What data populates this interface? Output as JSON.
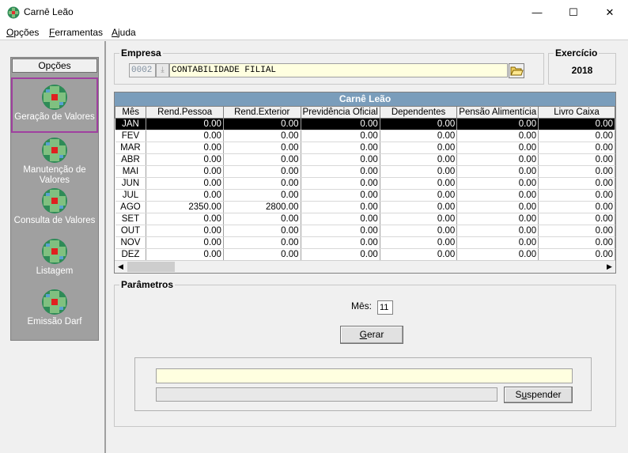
{
  "window": {
    "title": "Carnê Leão",
    "minimize_glyph": "—",
    "maximize_glyph": "☐",
    "close_glyph": "✕"
  },
  "menu": [
    {
      "label": "Opções",
      "underline": "O",
      "rest": "pções"
    },
    {
      "label": "Ferramentas",
      "underline": "F",
      "rest": "erramentas"
    },
    {
      "label": "Ajuda",
      "underline": "A",
      "rest": "juda"
    }
  ],
  "sidebar": {
    "header": "Opções",
    "items": [
      {
        "label": "Geração de Valores",
        "selected": true
      },
      {
        "label": "Manutenção de Valores",
        "selected": false
      },
      {
        "label": "Consulta de Valores",
        "selected": false
      },
      {
        "label": "Listagem",
        "selected": false
      },
      {
        "label": "Emissão Darf",
        "selected": false
      }
    ]
  },
  "empresa": {
    "group_label": "Empresa",
    "code": "0002",
    "name": "CONTABILIDADE FILIAL"
  },
  "exercicio": {
    "group_label": "Exercício",
    "year": "2018"
  },
  "grid": {
    "title": "Carnê Leão",
    "columns": [
      "Mês",
      "Rend.Pessoa",
      "Rend.Exterior",
      "Previdência Oficial",
      "Dependentes",
      "Pensão Alimentícia",
      "Livro Caixa"
    ],
    "rows": [
      [
        "JAN",
        "0.00",
        "0.00",
        "0.00",
        "0.00",
        "0.00",
        "0.00"
      ],
      [
        "FEV",
        "0.00",
        "0.00",
        "0.00",
        "0.00",
        "0.00",
        "0.00"
      ],
      [
        "MAR",
        "0.00",
        "0.00",
        "0.00",
        "0.00",
        "0.00",
        "0.00"
      ],
      [
        "ABR",
        "0.00",
        "0.00",
        "0.00",
        "0.00",
        "0.00",
        "0.00"
      ],
      [
        "MAI",
        "0.00",
        "0.00",
        "0.00",
        "0.00",
        "0.00",
        "0.00"
      ],
      [
        "JUN",
        "0.00",
        "0.00",
        "0.00",
        "0.00",
        "0.00",
        "0.00"
      ],
      [
        "JUL",
        "0.00",
        "0.00",
        "0.00",
        "0.00",
        "0.00",
        "0.00"
      ],
      [
        "AGO",
        "2350.00",
        "2800.00",
        "0.00",
        "0.00",
        "0.00",
        "0.00"
      ],
      [
        "SET",
        "0.00",
        "0.00",
        "0.00",
        "0.00",
        "0.00",
        "0.00"
      ],
      [
        "OUT",
        "0.00",
        "0.00",
        "0.00",
        "0.00",
        "0.00",
        "0.00"
      ],
      [
        "NOV",
        "0.00",
        "0.00",
        "0.00",
        "0.00",
        "0.00",
        "0.00"
      ],
      [
        "DEZ",
        "0.00",
        "0.00",
        "0.00",
        "0.00",
        "0.00",
        "0.00"
      ]
    ],
    "selected_row": 0
  },
  "parametros": {
    "group_label": "Parâmetros",
    "mes_label": "Mês:",
    "mes_value": "11",
    "gerar_label": "Gerar",
    "gerar_underline": "G",
    "gerar_rest": "erar",
    "suspender_label": "Suspender",
    "suspender_pre": "S",
    "suspender_underline": "u",
    "suspender_rest": "spender"
  }
}
